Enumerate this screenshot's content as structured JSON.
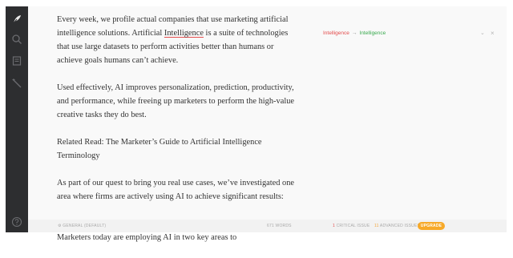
{
  "rail": {
    "icons": [
      "feather-icon",
      "search-icon",
      "book-icon",
      "magic-wand-icon",
      "help-icon"
    ]
  },
  "editor": {
    "p1": {
      "before": "Every week, we profile actual companies that use marketing artificial intelligence solutions. Artificial ",
      "flagged": "Intelligence",
      "after": " is a suite of technologies that use large datasets to perform activities better than humans or achieve goals humans can’t achieve."
    },
    "p2": "Used effectively, AI improves personalization, prediction, productivity, and performance, while freeing up marketers to perform the high-value creative tasks they do best.",
    "p3": "Related Read: The Marketer’s Guide to Artificial Intelligence Terminology",
    "p4": "As part of our quest to bring you real use cases, we’ve investigated one area where firms are actively using AI to achieve significant results:",
    "p5": "Consumer targeting, or the ability to find and reach potential customers. Marketers today are employing AI in two key areas to"
  },
  "suggestion": {
    "wrong": "Intelligence",
    "arrow": "→",
    "right": "Intelligence",
    "chevron": "⌄",
    "close": "×"
  },
  "status": {
    "mode": "GENERAL (DEFAULT)",
    "words": "671 WORDS",
    "critical_count": "1",
    "critical_label": "CRITICAL ISSUE",
    "advanced_count": "11",
    "advanced_label": "ADVANCED ISSUES",
    "upgrade": "UPGRADE"
  },
  "colors": {
    "rail": "#2d2e30",
    "error": "#e34d4d",
    "correct": "#3aaa4f",
    "upgrade": "#f7a928"
  }
}
